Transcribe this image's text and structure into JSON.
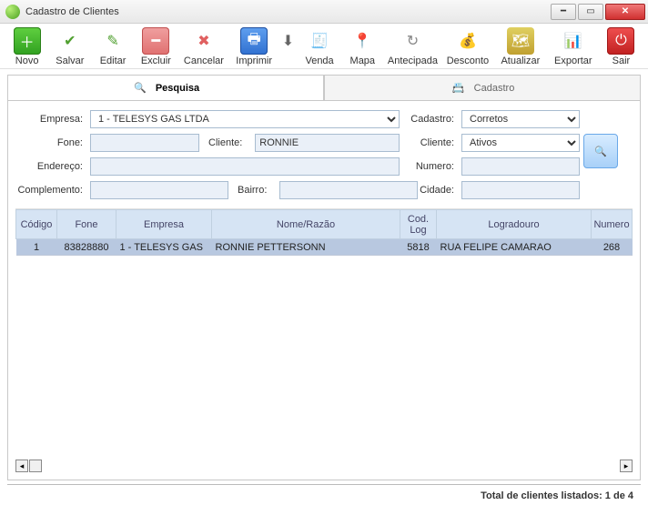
{
  "window": {
    "title": "Cadastro de Clientes"
  },
  "toolbar": {
    "novo": "Novo",
    "salvar": "Salvar",
    "editar": "Editar",
    "excluir": "Excluir",
    "cancelar": "Cancelar",
    "imprimir": "Imprimir",
    "venda": "Venda",
    "mapa": "Mapa",
    "antecipada": "Antecipada",
    "desconto": "Desconto",
    "atualizar": "Atualizar",
    "exportar": "Exportar",
    "sair": "Sair"
  },
  "tabs": {
    "pesquisa": "Pesquisa",
    "cadastro": "Cadastro"
  },
  "form": {
    "labels": {
      "empresa": "Empresa:",
      "fone": "Fone:",
      "cliente": "Cliente:",
      "endereco": "Endereço:",
      "complemento": "Complemento:",
      "bairro": "Bairro:",
      "cadastro": "Cadastro:",
      "cliente2": "Cliente:",
      "numero": "Numero:",
      "cidade": "Cidade:"
    },
    "values": {
      "empresa": "1 - TELESYS GAS LTDA",
      "fone": "",
      "cliente": "RONNIE",
      "endereco": "",
      "complemento": "",
      "bairro": "",
      "cadastro": "Corretos",
      "cliente2": "Ativos",
      "numero": "",
      "cidade": ""
    }
  },
  "table": {
    "headers": {
      "codigo": "Código",
      "fone": "Fone",
      "empresa": "Empresa",
      "nome": "Nome/Razão",
      "codlog": "Cod. Log",
      "logradouro": "Logradouro",
      "numero": "Numero"
    },
    "rows": [
      {
        "codigo": "1",
        "fone": "83828880",
        "empresa": "1 - TELESYS GAS",
        "nome": "RONNIE PETTERSONN",
        "codlog": "5818",
        "logradouro": "RUA FELIPE CAMARAO",
        "numero": "268"
      }
    ]
  },
  "footer": {
    "total": "Total de clientes listados: 1 de 4"
  }
}
